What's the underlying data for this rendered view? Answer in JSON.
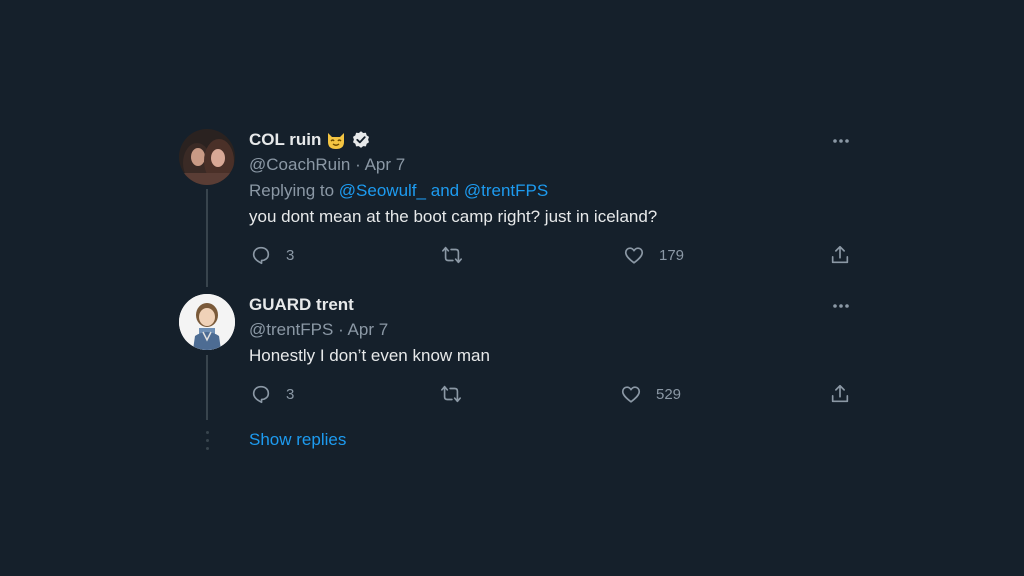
{
  "tweets": [
    {
      "display_name": "COL ruin",
      "handle": "@CoachRuin",
      "separator": "·",
      "date": "Apr 7",
      "replying_prefix": "Replying to",
      "reply_user_1": "@Seowulf_",
      "reply_and": "and",
      "reply_user_2": "@trentFPS",
      "text": "you dont mean at the boot camp right? just in iceland?",
      "replies": "3",
      "likes": "179"
    },
    {
      "display_name": "GUARD trent",
      "handle": "@trentFPS",
      "separator": "·",
      "date": "Apr 7",
      "text": "Honestly I don’t even know man",
      "replies": "3",
      "likes": "529"
    }
  ],
  "show_replies": "Show replies",
  "colors": {
    "background": "#15202b",
    "link": "#1d9bf0",
    "muted": "#8b98a5",
    "text": "#e7e9ea"
  }
}
